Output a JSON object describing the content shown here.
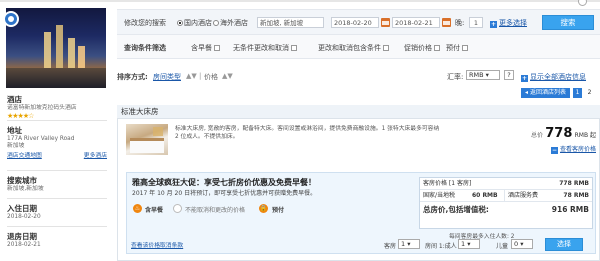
{
  "search": {
    "label": "修改您的搜索",
    "radio_domestic": "国内酒店",
    "radio_overseas": "海外酒店",
    "city_value": "新加坡, 新加坡",
    "checkin": "2018-02-20",
    "checkout": "2018-02-21",
    "nights_label": "晚:",
    "nights_value": "1",
    "more_options": "更多选择",
    "search_button": "搜索"
  },
  "filter": {
    "label": "查询条件筛选",
    "options": [
      "含早餐",
      "无条件更改和取消",
      "更改和取消包含条件",
      "促销价格",
      "预付"
    ]
  },
  "sort": {
    "label": "排序方式:",
    "room_type": "房间类型",
    "price": "价格",
    "currency_label": "汇率:",
    "currency_value": "RMB",
    "help": "?",
    "show_all": "显示全部酒店信息",
    "back_to_list": "返回酒店列表",
    "pages": [
      "1",
      "2"
    ]
  },
  "sidebar": {
    "hotel_heading": "酒店",
    "hotel_name": "诺富特新加坡克拉码头酒店",
    "stars": "★★★★☆",
    "address_heading": "地址",
    "address_line1": "177A River Valley Road",
    "address_line2": "新加坡",
    "hotel_link": "酒店交通地图",
    "more_link": "更多酒店",
    "city_heading": "搜索城市",
    "city_value": "新加坡,新加坡",
    "checkin_heading": "入住日期",
    "checkin_value": "2018-02-20",
    "checkout_heading": "退房日期",
    "checkout_value": "2018-02-21"
  },
  "room": {
    "title": "标准大床房",
    "description": "标准大床房, 宽敞的客房，配备特大床。客间设置或淋浴间，提供免费商融设施。1 张特大床最多可容纳 2 位成人。不提供加床。",
    "total_label": "总价",
    "price": "778",
    "currency": "RMB 起",
    "view_rate": "查看客房价格"
  },
  "promo": {
    "title": "雅高全球疯狂大促：享受七折房价优惠及免费早餐！",
    "subtitle": "2017 年 10 月 20 日将预订，即可享受七折优惠并可获赠免费早餐。",
    "tag_breakfast": "含早餐",
    "tag_noncancel": "不能取消和更改的价格",
    "tag_prepay": "预付",
    "room_price_label": "客房价格 [1 客房]",
    "room_price_value": "778 RMB",
    "tax_label": "国家/当地税",
    "tax_value": "60 RMB",
    "service_label": "酒店服务费",
    "service_value": "78 RMB",
    "total_label": "总房价,包括增值税:",
    "total_value": "916 RMB",
    "max_occupancy": "每间客房最多入住人数: 2",
    "terms_link": "查看该价格取消条款",
    "rooms_label": "客房",
    "rooms_value": "1",
    "room1_label": "房间 1:成人",
    "adults_value": "1",
    "children_label": "儿童",
    "children_value": "0",
    "select_button": "选择"
  },
  "colors": {
    "accent": "#39a3ee",
    "link": "#1a57a8",
    "brand_orange": "#d9702a"
  }
}
